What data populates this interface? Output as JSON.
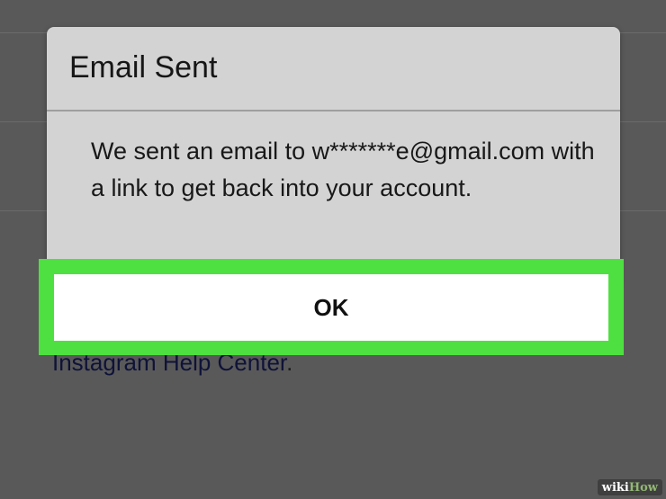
{
  "background": {
    "help_text_prefix": "Instagram Help Center",
    "help_text_suffix": "."
  },
  "dialog": {
    "title": "Email Sent",
    "message": "We sent an email to w*******e@gmail.com with a link to get back into your account.",
    "ok_label": "OK"
  },
  "colors": {
    "highlight": "#4ee041",
    "dialog_bg": "#d3d3d3",
    "overlay": "#595959"
  },
  "watermark": {
    "part1": "wiki",
    "part2": "How"
  }
}
